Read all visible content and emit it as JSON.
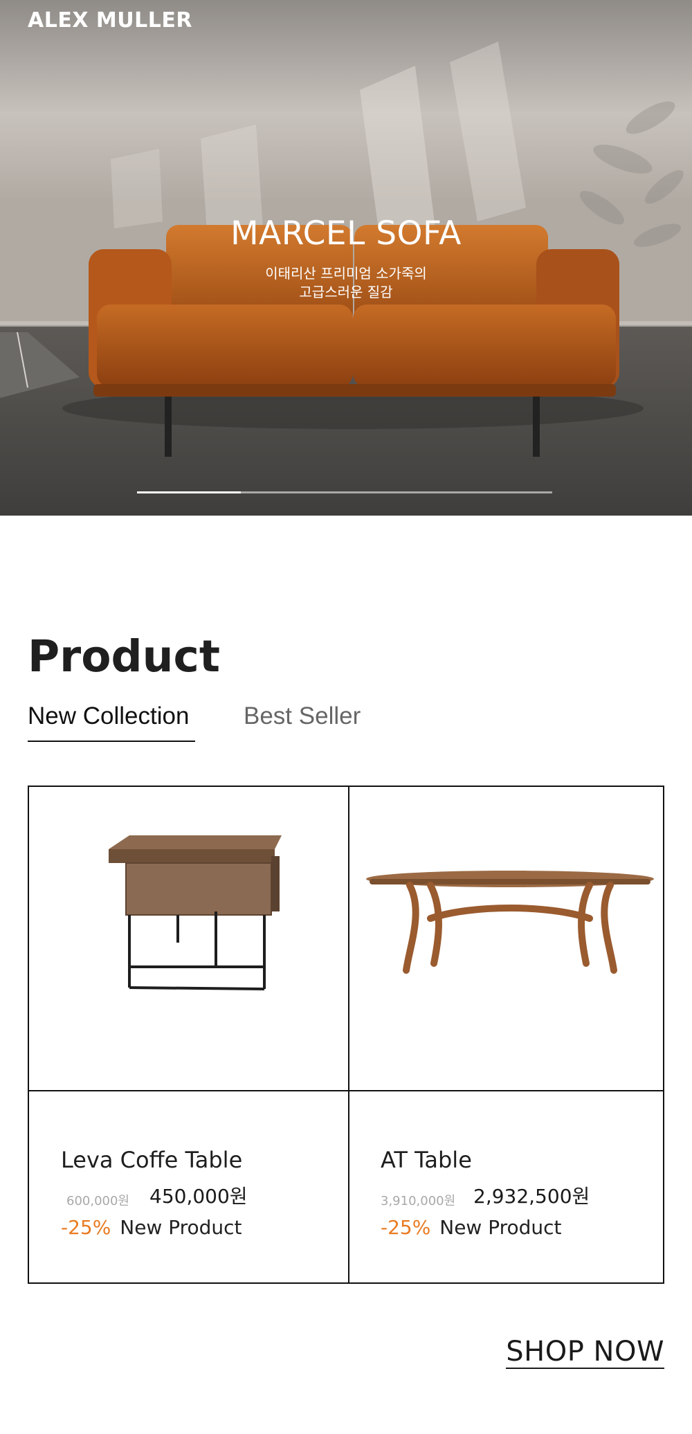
{
  "brand": "ALEX MULLER",
  "hero": {
    "title": "MARCEL SOFA",
    "subtitle_lines": [
      "이태리산 프리미엄 소가죽의",
      "고급스러운 질감"
    ],
    "slider_progress": 0.25
  },
  "section": {
    "title": "Product",
    "tabs": [
      {
        "label": "New Collection",
        "active": true
      },
      {
        "label": "Best Seller",
        "active": false
      }
    ]
  },
  "products": [
    {
      "name": "Leva Coffe Table",
      "original_price": "600,000원",
      "price": "450,000원",
      "discount": "-25%",
      "badge": "New Product",
      "image_icon": "side-table-image"
    },
    {
      "name": "AT Table",
      "original_price": "3,910,000원",
      "price": "2,932,500원",
      "discount": "-25%",
      "badge": "New Product",
      "image_icon": "oval-table-image"
    }
  ],
  "cta": {
    "label": "SHOP NOW"
  },
  "colors": {
    "accent": "#e87b22",
    "text": "#1a1a1a",
    "border": "#111111"
  }
}
